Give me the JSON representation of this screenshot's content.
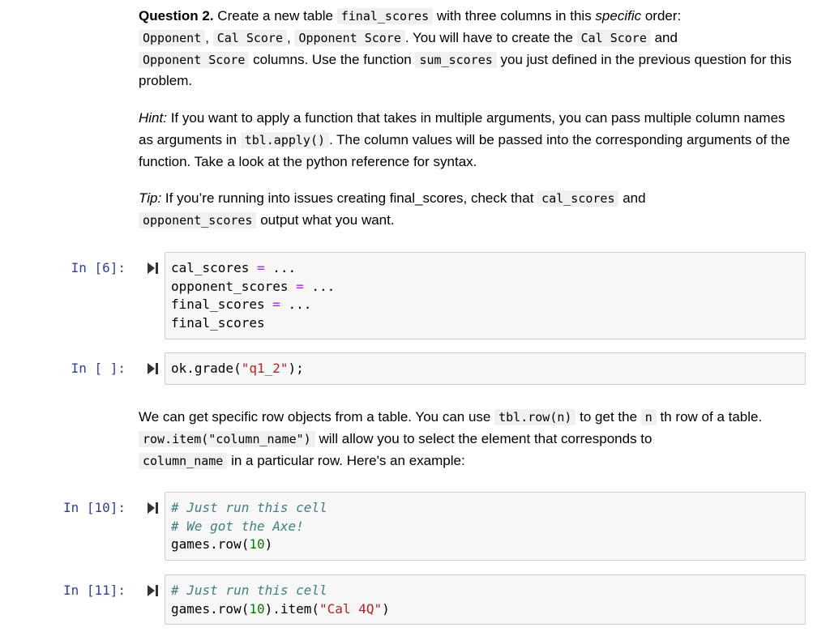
{
  "q2": {
    "title": "Question 2.",
    "t1": " Create a new table ",
    "c1": "final_scores",
    "t2": " with three columns in this ",
    "em1": "specific",
    "t3": " order:",
    "c2": "Opponent",
    "t4": ", ",
    "c3": "Cal Score",
    "t5": ", ",
    "c4": "Opponent Score",
    "t6": ". You will have to create the ",
    "c5": "Cal Score",
    "t7": " and ",
    "c6": "Opponent Score",
    "t8": " columns. Use the function ",
    "c7": "sum_scores",
    "t9": " you just defined in the previous question for this problem."
  },
  "hint": {
    "label": "Hint:",
    "t1": " If you want to apply a function that takes in multiple arguments, you can pass multiple column names as arguments in ",
    "c1": "tbl.apply()",
    "t2": ". The column values will be passed into the corresponding arguments of the function. Take a look at the python reference for syntax."
  },
  "tip": {
    "label": "Tip:",
    "t1": " If you’re running into issues creating final_scores, check that ",
    "c1": "cal_scores",
    "t2": " and ",
    "c2": "opponent_scores",
    "t3": " output what you want."
  },
  "cells": [
    {
      "prompt": "In [6]:",
      "l1a": "cal_scores ",
      "l1op": "=",
      "l1b": " ...",
      "l2a": "opponent_scores ",
      "l2op": "=",
      "l2b": " ...",
      "l3a": "final_scores ",
      "l3op": "=",
      "l3b": " ...",
      "l4": "final_scores"
    },
    {
      "prompt": "In [ ]:",
      "l1a": "ok.grade(",
      "l1s": "\"q1_2\"",
      "l1b": ");"
    },
    {
      "prompt": "In [10]:",
      "l1c": "# Just run this cell",
      "l2c": "# We got the Axe!",
      "l3a": "games.row(",
      "l3n": "10",
      "l3b": ")"
    },
    {
      "prompt": "In [11]:",
      "l1c": "# Just run this cell",
      "l2a": "games.row(",
      "l2n": "10",
      "l2b": ").item(",
      "l2s": "\"Cal 4Q\"",
      "l2c2": ")"
    }
  ],
  "md2": {
    "t1": "We can get specific row objects from a table. You can use ",
    "c1": "tbl.row(n)",
    "t2": " to get the ",
    "c2": "n",
    "t3": " th row of a table. ",
    "c3": "row.item(\"column_name\")",
    "t4": " will allow you to select the element that corresponds to ",
    "c4": "column_name",
    "t5": " in a particular row. Here's an example:"
  },
  "colors": {
    "prompt": "#303f9f",
    "cell_bg": "#f7f7f7",
    "inline_code_bg": "#eff0f1"
  },
  "icons": {
    "run": "run-cell-icon"
  }
}
